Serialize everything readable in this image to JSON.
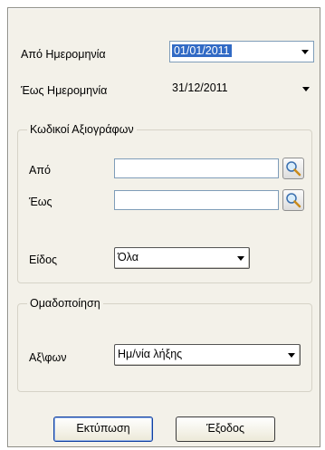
{
  "date_from": {
    "label": "Από Ημερομηνία",
    "value": "01/01/2011"
  },
  "date_to": {
    "label": "Έως Ημερομηνία",
    "value": "31/12/2011"
  },
  "securities_group": {
    "title": "Κωδικοί Αξιογράφων",
    "from_label": "Από",
    "from_value": "",
    "to_label": "Έως",
    "to_value": "",
    "type_label": "Είδος",
    "type_value": "Όλα"
  },
  "grouping_group": {
    "title": "Ομαδοποίηση",
    "label": "Αξ\\φων",
    "value": "Ημ/νία λήξης"
  },
  "buttons": {
    "print": "Εκτύπωση",
    "exit": "Έξοδος"
  },
  "icons": {
    "search": "magnifier-search-icon",
    "dropdown": "chevron-down-icon"
  },
  "colors": {
    "selection": "#316ac5",
    "dialog_bg": "#f3f1e9",
    "input_border": "#7f9db9"
  }
}
